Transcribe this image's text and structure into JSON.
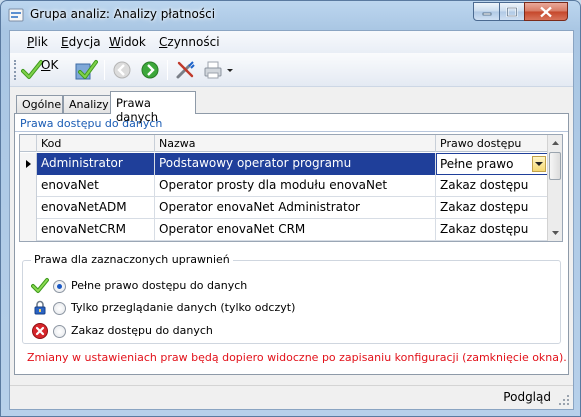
{
  "window": {
    "title": "Grupa analiz: Analizy płatności"
  },
  "menu": {
    "items": [
      "Plik",
      "Edycja",
      "Widok",
      "Czynności"
    ]
  },
  "toolbar": {
    "ok_label": "OK"
  },
  "tabs": [
    {
      "label": "Ogólne",
      "active": false
    },
    {
      "label": "Analizy",
      "active": false
    },
    {
      "label": "Prawa danych",
      "active": true
    }
  ],
  "rights_section": {
    "title": "Prawa dostępu do danych",
    "columns": [
      "Kod",
      "Nazwa",
      "Prawo dostępu"
    ],
    "rows": [
      {
        "kod": "Administrator",
        "nazwa": "Podstawowy operator programu",
        "prawo": "Pełne prawo",
        "selected": true
      },
      {
        "kod": "enovaNet",
        "nazwa": "Operator prosty dla modułu enovaNet",
        "prawo": "Zakaz dostępu",
        "selected": false
      },
      {
        "kod": "enovaNetADM",
        "nazwa": "Operator enovaNet Administrator",
        "prawo": "Zakaz dostępu",
        "selected": false
      },
      {
        "kod": "enovaNetCRM",
        "nazwa": "Operator enovaNet CRM",
        "prawo": "Zakaz dostępu",
        "selected": false
      }
    ]
  },
  "permissions": {
    "title": "Prawa dla zaznaczonych uprawnień",
    "options": [
      {
        "label": "Pełne prawo dostępu do danych",
        "checked": true,
        "icon": "check-icon"
      },
      {
        "label": "Tylko przeglądanie danych (tylko odczyt)",
        "checked": false,
        "icon": "lock-icon"
      },
      {
        "label": "Zakaz dostępu do danych",
        "checked": false,
        "icon": "deny-icon"
      }
    ]
  },
  "note": "Zmiany w ustawieniach praw będą dopiero widoczne po zapisaniu konfiguracji (zamknięcie okna).",
  "status": {
    "text": "Podgląd"
  },
  "colors": {
    "selection": "#1f3f9a",
    "note": "#e2111a",
    "section_title": "#1a5cb4"
  }
}
